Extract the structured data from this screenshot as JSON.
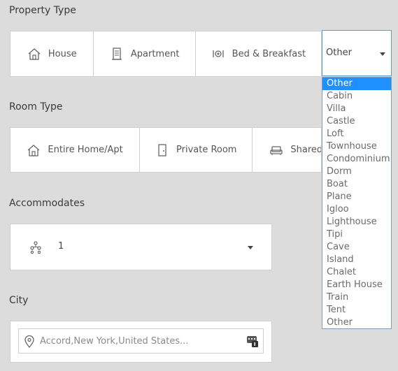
{
  "property_type": {
    "label": "Property Type",
    "buttons": [
      {
        "label": "House",
        "icon": "house-icon"
      },
      {
        "label": "Apartment",
        "icon": "apartment-icon"
      },
      {
        "label": "Bed & Breakfast",
        "icon": "bed-and-breakfast-icon"
      }
    ],
    "select": {
      "value": "Other",
      "options": [
        "Other",
        "Cabin",
        "Villa",
        "Castle",
        "Loft",
        "Townhouse",
        "Condominium",
        "Dorm",
        "Boat",
        "Plane",
        "Igloo",
        "Lighthouse",
        "Tipi",
        "Cave",
        "Island",
        "Chalet",
        "Earth House",
        "Train",
        "Tent",
        "Other"
      ],
      "highlighted_index": 0
    }
  },
  "room_type": {
    "label": "Room Type",
    "buttons": [
      {
        "label": "Entire Home/Apt",
        "icon": "house-icon"
      },
      {
        "label": "Private Room",
        "icon": "door-icon"
      },
      {
        "label": "Shared",
        "icon": "couch-icon"
      }
    ]
  },
  "accommodates": {
    "label": "Accommodates",
    "value": "1",
    "icon": "guests-icon"
  },
  "city": {
    "label": "City",
    "placeholder": "Accord,New York,United States...",
    "icon": "location-pin-icon",
    "action_icon": "keyboard-badge-icon"
  },
  "colors": {
    "background": "#dcdcdc",
    "selected_option": "#1e90ff",
    "select_focus_border": "#5b9bd5"
  }
}
